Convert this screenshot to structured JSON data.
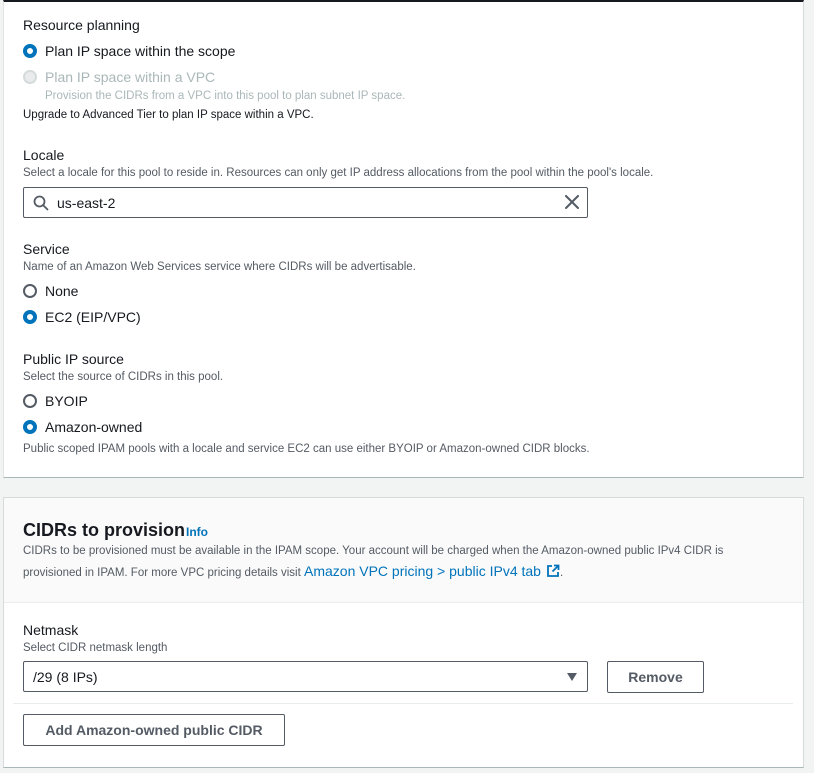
{
  "resource_planning": {
    "label": "Resource planning",
    "options": [
      {
        "label": "Plan IP space within the scope",
        "checked": true,
        "disabled": false
      },
      {
        "label": "Plan IP space within a VPC",
        "checked": false,
        "disabled": true,
        "description": "Provision the CIDRs from a VPC into this pool to plan subnet IP space."
      }
    ],
    "note": "Upgrade to Advanced Tier to plan IP space within a VPC."
  },
  "locale": {
    "label": "Locale",
    "description": "Select a locale for this pool to reside in. Resources can only get IP address allocations from the pool within the pool's locale.",
    "value": "us-east-2"
  },
  "service": {
    "label": "Service",
    "description": "Name of an Amazon Web Services service where CIDRs will be advertisable.",
    "options": [
      {
        "label": "None",
        "checked": false
      },
      {
        "label": "EC2 (EIP/VPC)",
        "checked": true
      }
    ]
  },
  "public_ip_source": {
    "label": "Public IP source",
    "description": "Select the source of CIDRs in this pool.",
    "options": [
      {
        "label": "BYOIP",
        "checked": false
      },
      {
        "label": "Amazon-owned",
        "checked": true
      }
    ],
    "note": "Public scoped IPAM pools with a locale and service EC2 can use either BYOIP or Amazon-owned CIDR blocks."
  },
  "cidrs": {
    "title": "CIDRs to provision",
    "info": "Info",
    "description_line1": "CIDRs to be provisioned must be available in the IPAM scope. Your account will be charged when the Amazon-owned public IPv4 CIDR is",
    "description_line2_prefix": "provisioned in IPAM. For more VPC pricing details visit ",
    "link_text": "Amazon VPC pricing > public IPv4 tab",
    "description_line2_suffix": ".",
    "netmask_label": "Netmask",
    "netmask_description": "Select CIDR netmask length",
    "netmask_value": "/29 (8 IPs)",
    "remove_button": "Remove",
    "add_button": "Add Amazon-owned public CIDR"
  },
  "colors": {
    "accent": "#0073bb",
    "text": "#16191f",
    "secondary_text": "#545b64",
    "disabled": "#aab7b8"
  }
}
